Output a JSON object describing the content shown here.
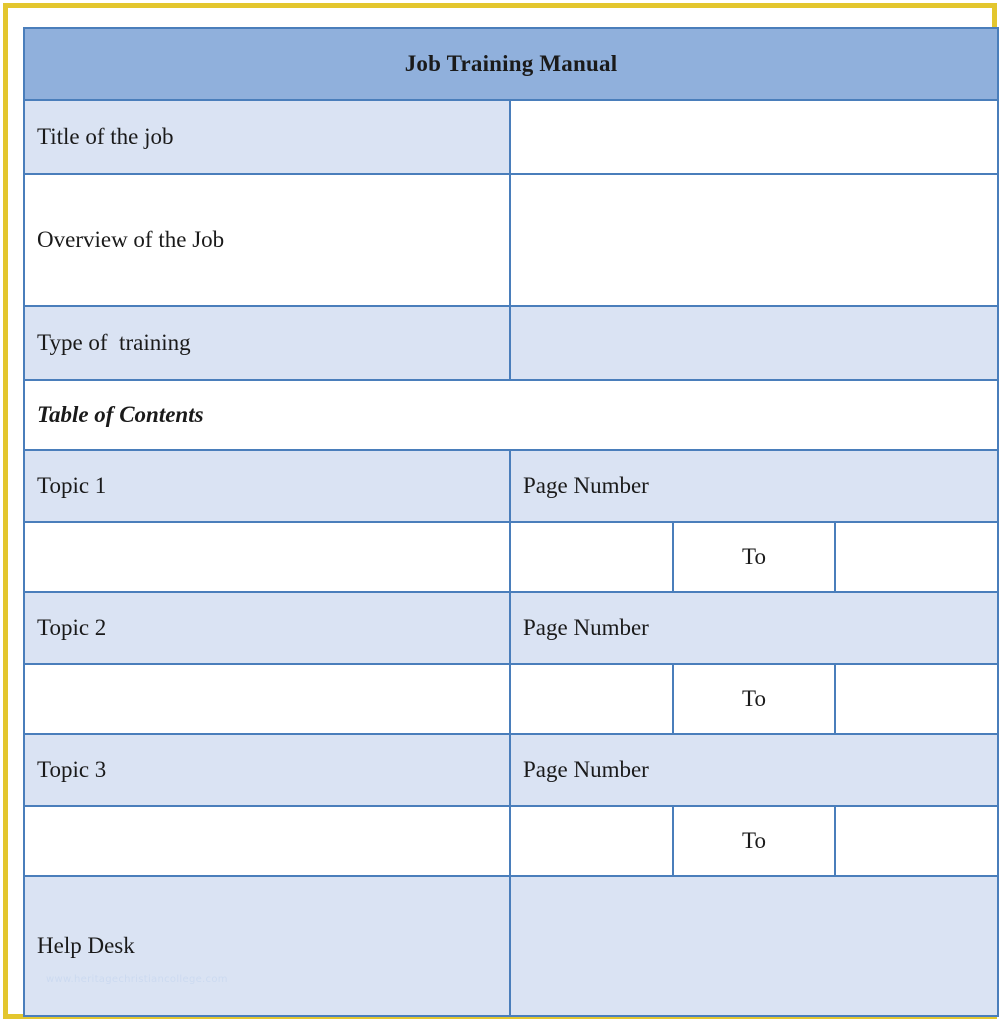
{
  "document": {
    "title": "Job Training Manual",
    "watermark": "www.heritagechristiancollege.com"
  },
  "colors": {
    "outer_frame": "#e3c62e",
    "title_banner": "#90b0dc",
    "cell_tint": "#dae3f3",
    "cell_white": "#ffffff",
    "border": "#4a7ebb",
    "text": "#1a1a1a",
    "watermark": "#ccdaf0"
  },
  "fields": [
    {
      "label": "Title of the job",
      "value": ""
    },
    {
      "label": "Overview of the Job",
      "value": ""
    },
    {
      "label": "Type of  training",
      "value": ""
    }
  ],
  "toc": {
    "heading": "Table of Contents",
    "page_number_label": "Page Number",
    "range_label": "To",
    "entries": [
      {
        "topic": "Topic 1",
        "page_label": "Page Number",
        "page_from": "",
        "to": "To",
        "page_until": ""
      },
      {
        "topic": "Topic 2",
        "page_label": "Page Number",
        "page_from": "",
        "to": "To",
        "page_until": ""
      },
      {
        "topic": "Topic 3",
        "page_label": "Page Number",
        "page_from": "",
        "to": "To",
        "page_until": ""
      }
    ]
  },
  "footer": {
    "label": "Help Desk",
    "value": ""
  }
}
